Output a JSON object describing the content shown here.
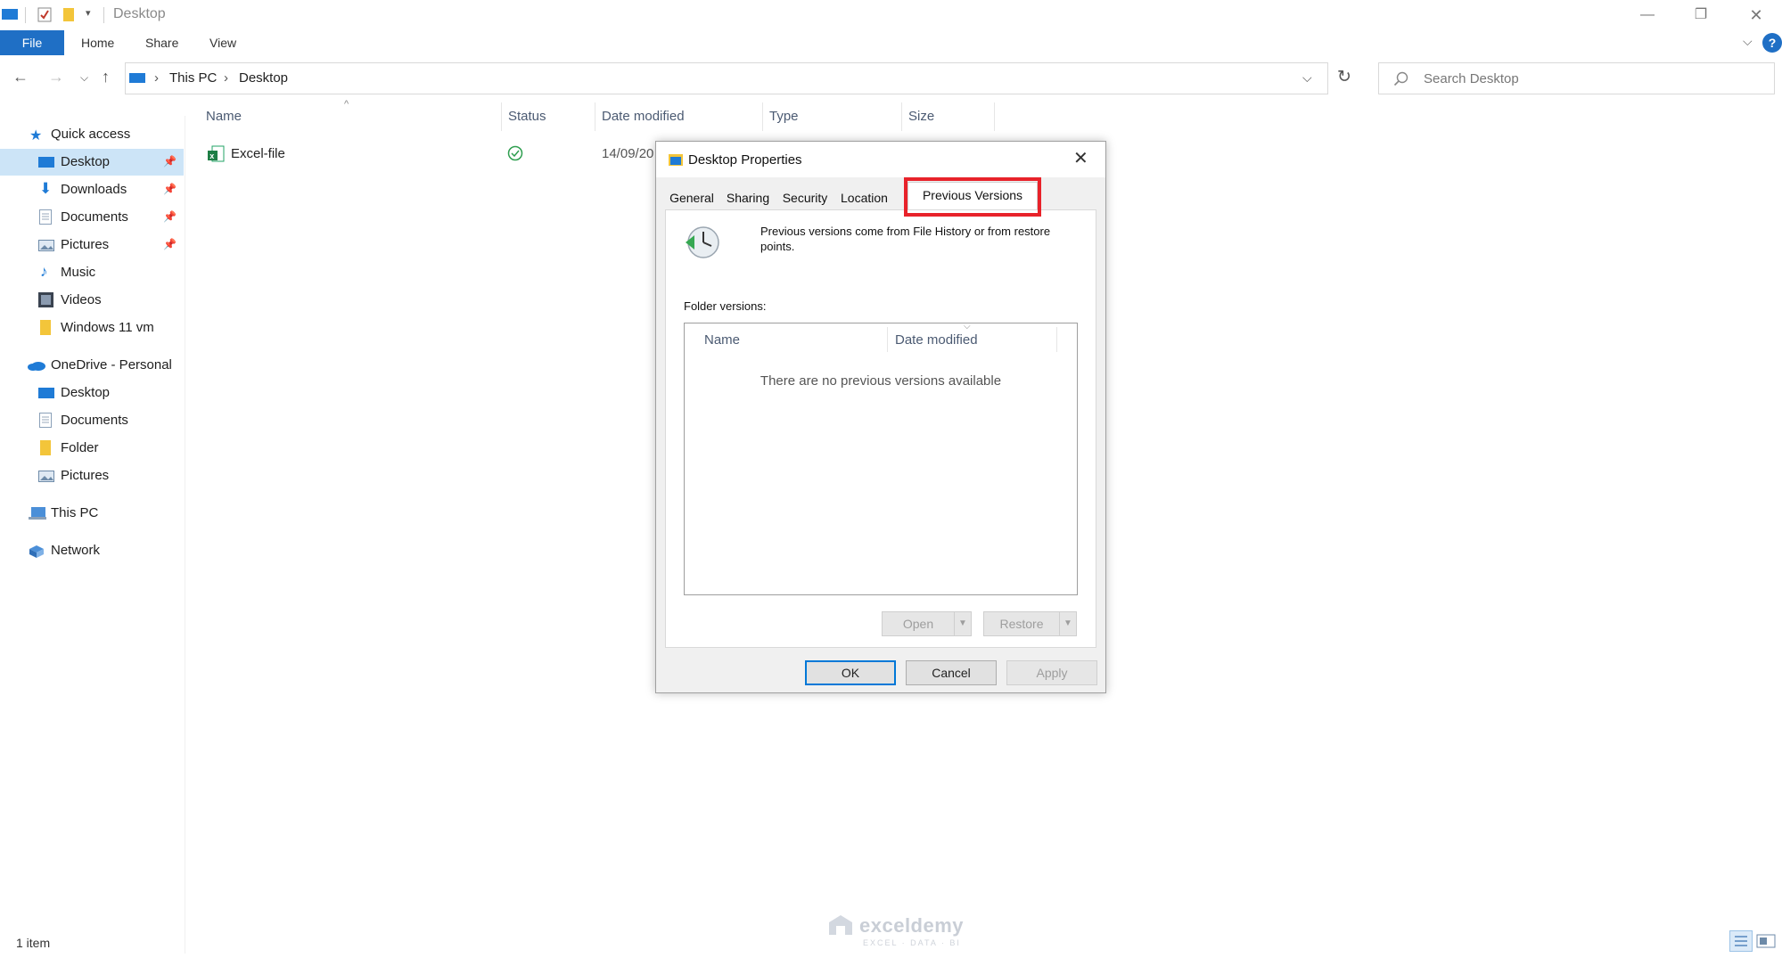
{
  "window": {
    "title": "Desktop"
  },
  "ribbon": {
    "tabs": [
      "File",
      "Home",
      "Share",
      "View"
    ]
  },
  "address": {
    "breadcrumb": [
      "This PC",
      "Desktop"
    ]
  },
  "search": {
    "placeholder": "Search Desktop"
  },
  "nav": {
    "quick_access": "Quick access",
    "qa_items": [
      {
        "label": "Desktop",
        "pinned": true,
        "icon": "desktop-icon"
      },
      {
        "label": "Downloads",
        "pinned": true,
        "icon": "download-icon"
      },
      {
        "label": "Documents",
        "pinned": true,
        "icon": "document-icon"
      },
      {
        "label": "Pictures",
        "pinned": true,
        "icon": "picture-icon"
      },
      {
        "label": "Music",
        "pinned": false,
        "icon": "music-icon"
      },
      {
        "label": "Videos",
        "pinned": false,
        "icon": "video-icon"
      },
      {
        "label": "Windows 11 vm",
        "pinned": false,
        "icon": "folder-icon"
      }
    ],
    "onedrive": "OneDrive - Personal",
    "od_items": [
      {
        "label": "Desktop",
        "icon": "desktop-icon"
      },
      {
        "label": "Documents",
        "icon": "document-icon"
      },
      {
        "label": "Folder",
        "icon": "folder-icon"
      },
      {
        "label": "Pictures",
        "icon": "picture-icon"
      }
    ],
    "this_pc": "This PC",
    "network": "Network"
  },
  "filelist": {
    "columns": [
      "Name",
      "Status",
      "Date modified",
      "Type",
      "Size"
    ],
    "rows": [
      {
        "name": "Excel-file",
        "status": "synced",
        "date": "14/09/20"
      }
    ]
  },
  "status": {
    "count": "1 item"
  },
  "dialog": {
    "title": "Desktop Properties",
    "tabs": [
      "General",
      "Sharing",
      "Security",
      "Location",
      "Previous Versions"
    ],
    "active_tab": "Previous Versions",
    "info_line1": "Previous versions come from File History or from restore",
    "info_line2": "points.",
    "folder_versions_label": "Folder versions:",
    "table_columns": [
      "Name",
      "Date modified"
    ],
    "empty_message": "There are no previous versions available",
    "open_label": "Open",
    "restore_label": "Restore",
    "ok_label": "OK",
    "cancel_label": "Cancel",
    "apply_label": "Apply"
  },
  "watermark": {
    "main": "exceldemy",
    "sub": "EXCEL · DATA · BI"
  },
  "colors": {
    "accent": "#1f6fc5",
    "highlight": "#e8222a",
    "selected": "#cce4f7"
  }
}
